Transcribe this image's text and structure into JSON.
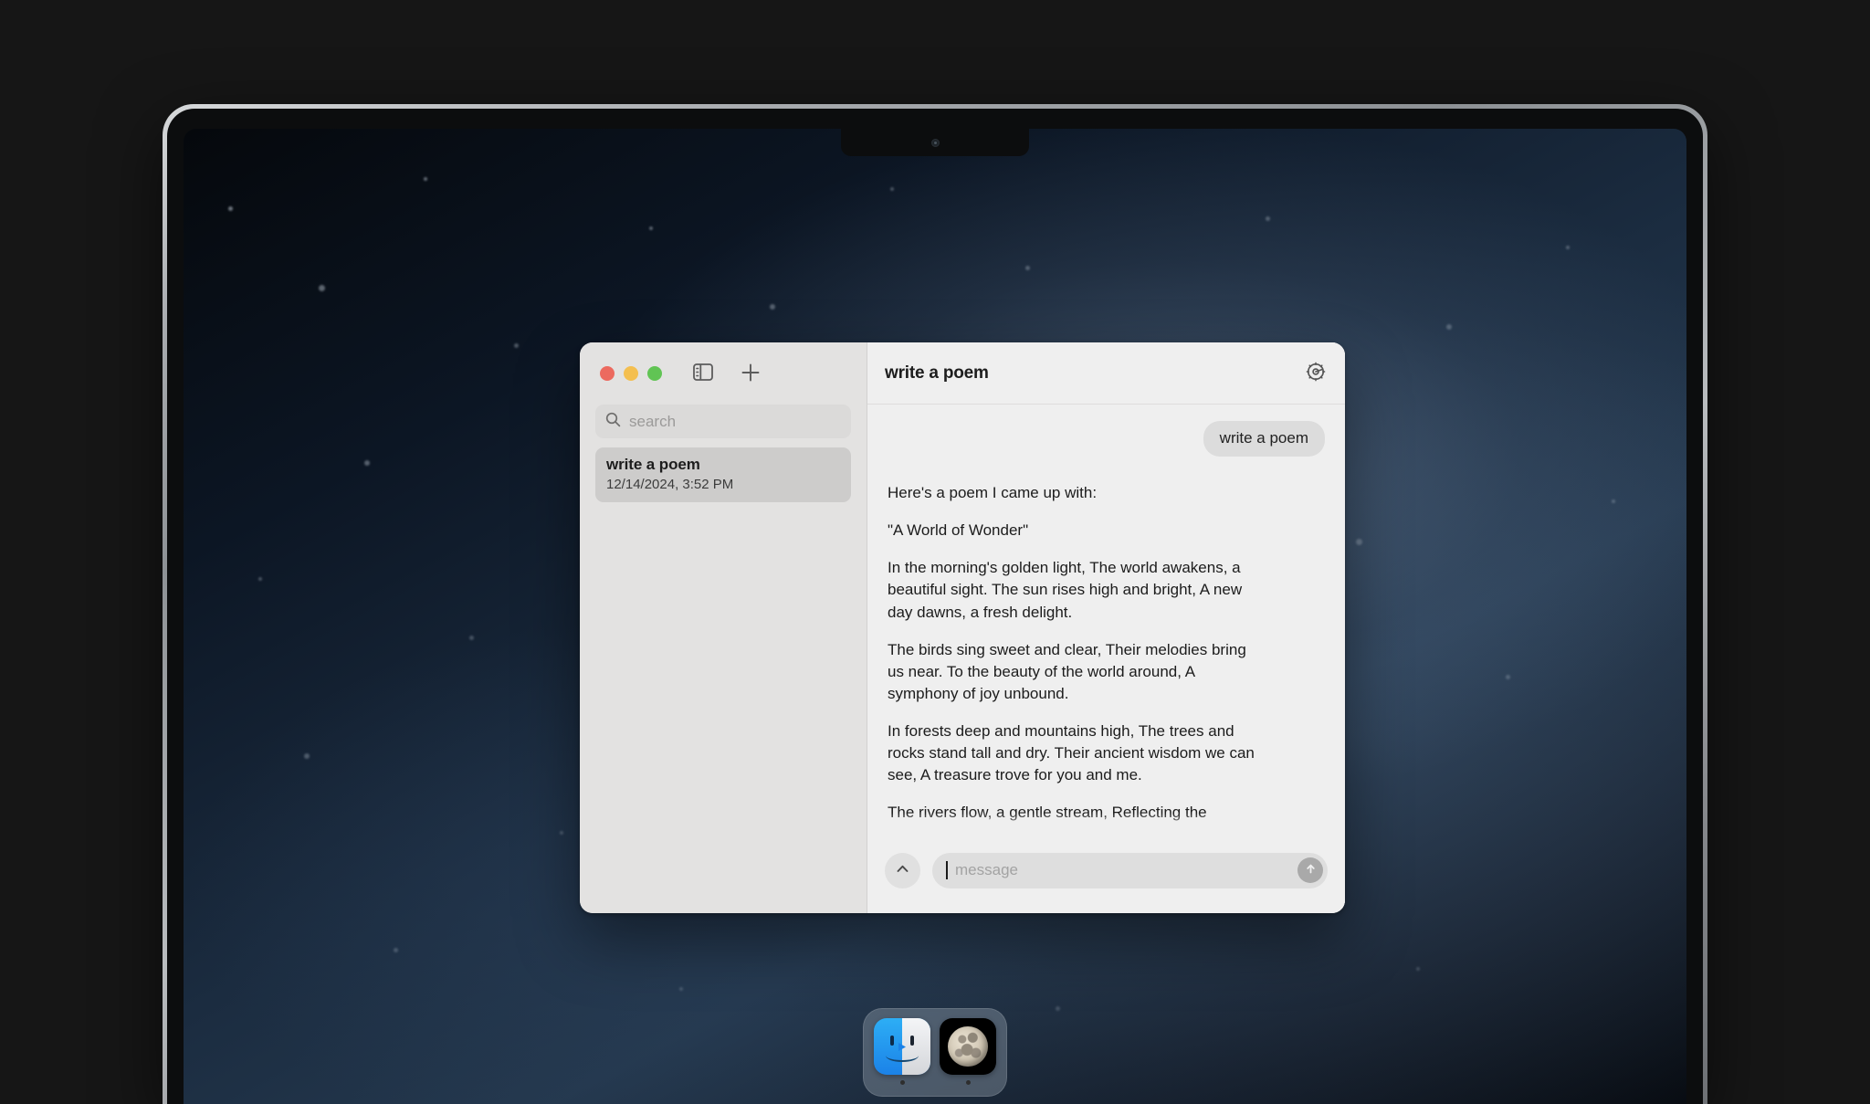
{
  "window_controls": {
    "close_label": "close",
    "minimize_label": "minimize",
    "maximize_label": "maximize"
  },
  "sidebar": {
    "toggle_sidebar_icon": "sidebar-toggle-icon",
    "new_chat_icon": "plus-icon",
    "search": {
      "placeholder": "search",
      "value": "",
      "icon": "search-icon"
    },
    "chats": [
      {
        "title": "write a poem",
        "date": "12/14/2024, 3:52 PM",
        "selected": true
      }
    ]
  },
  "main": {
    "header": {
      "title": "write a poem",
      "settings_icon": "gear-icon"
    },
    "messages": [
      {
        "role": "user",
        "text": "write a poem"
      },
      {
        "role": "assistant",
        "paragraphs": [
          "Here's a poem I came up with:",
          "\"A World of Wonder\"",
          "In the morning's golden light, The world awakens, a beautiful sight. The sun rises high and bright, A new day dawns, a fresh delight.",
          "The birds sing sweet and clear, Their melodies bring us near. To the beauty of the world around, A symphony of joy unbound.",
          "In forests deep and mountains high, The trees and rocks stand tall and dry. Their ancient wisdom we can see, A treasure trove for you and me.",
          "The rivers flow, a gentle stream, Reflecting the"
        ]
      }
    ],
    "composer": {
      "expand_icon": "chevron-up-icon",
      "input": {
        "placeholder": "message",
        "value": ""
      },
      "send_icon": "arrow-up-icon"
    }
  },
  "dock": {
    "items": [
      {
        "name": "Finder",
        "icon": "finder-icon",
        "running": true
      },
      {
        "name": "Moon",
        "icon": "moon-icon",
        "running": true
      }
    ]
  },
  "colors": {
    "traffic_red": "#ec6a5f",
    "traffic_yellow": "#f4bf50",
    "traffic_green": "#61c454",
    "sidebar_bg": "#e3e2e1",
    "main_bg": "#efefef",
    "selected_item": "#cdcccb"
  }
}
